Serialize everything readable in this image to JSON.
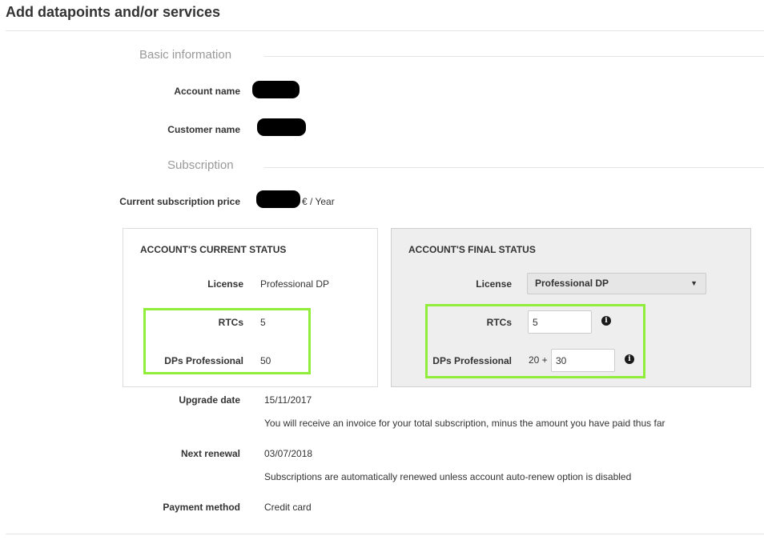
{
  "page": {
    "title": "Add datapoints and/or services"
  },
  "basic_info": {
    "section_title": "Basic information",
    "account_name_label": "Account name",
    "customer_name_label": "Customer name"
  },
  "subscription": {
    "section_title": "Subscription",
    "price_label": "Current subscription price",
    "price_suffix": "€ / Year"
  },
  "current_status": {
    "heading": "ACCOUNT'S CURRENT STATUS",
    "license_label": "License",
    "license_value": "Professional DP",
    "rtcs_label": "RTCs",
    "rtcs_value": "5",
    "dps_label": "DPs Professional",
    "dps_value": "50"
  },
  "final_status": {
    "heading": "ACCOUNT'S FINAL STATUS",
    "license_label": "License",
    "license_selected": "Professional DP",
    "rtcs_label": "RTCs",
    "rtcs_value": "5",
    "dps_label": "DPs Professional",
    "dps_prefix": "20 +",
    "dps_value": "30"
  },
  "details": {
    "upgrade_date_label": "Upgrade date",
    "upgrade_date_value": "15/11/2017",
    "upgrade_note": "You will receive an invoice for your total subscription, minus the amount you have paid thus far",
    "next_renewal_label": "Next renewal",
    "next_renewal_value": "03/07/2018",
    "renewal_note": "Subscriptions are automatically renewed unless account auto-renew option is disabled",
    "payment_method_label": "Payment method",
    "payment_method_value": "Credit card"
  },
  "colors": {
    "highlight": "#90ee3a",
    "section_title": "#999999"
  },
  "icons": {
    "info": "i",
    "caret": "▼"
  }
}
